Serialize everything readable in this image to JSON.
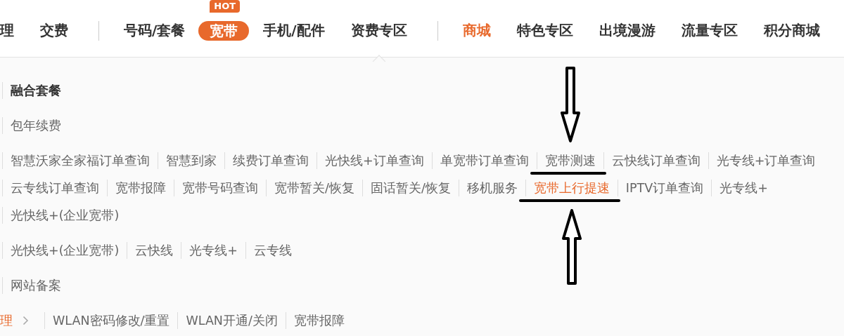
{
  "nav": [
    {
      "label": "理",
      "selected": false,
      "kind": "link"
    },
    {
      "label": "交费",
      "selected": false,
      "kind": "link"
    },
    {
      "kind": "divider"
    },
    {
      "label": "号码/套餐",
      "selected": false,
      "kind": "link"
    },
    {
      "label": "宽带",
      "selected": false,
      "kind": "hot",
      "badge": "HOT"
    },
    {
      "label": "手机/配件",
      "selected": false,
      "kind": "link"
    },
    {
      "label": "资费专区",
      "selected": false,
      "kind": "link",
      "pointer": true
    },
    {
      "kind": "divider"
    },
    {
      "label": "商城",
      "selected": true,
      "kind": "link"
    },
    {
      "label": "特色专区",
      "selected": false,
      "kind": "link"
    },
    {
      "label": "出境漫游",
      "selected": false,
      "kind": "link"
    },
    {
      "label": "流量专区",
      "selected": false,
      "kind": "link"
    },
    {
      "label": "积分商城",
      "selected": false,
      "kind": "link"
    }
  ],
  "groups": [
    {
      "kind": "heading",
      "lines": [
        [
          {
            "label": "融合套餐",
            "selected": false
          }
        ]
      ]
    },
    {
      "kind": "list",
      "lines": [
        [
          {
            "label": "包年续费",
            "selected": false
          }
        ]
      ]
    },
    {
      "kind": "list",
      "lines": [
        [
          {
            "label": "智慧沃家全家福订单查询",
            "selected": false
          },
          {
            "label": "智慧到家",
            "selected": false
          },
          {
            "label": "续费订单查询",
            "selected": false
          },
          {
            "label": "光快线+订单查询",
            "selected": false
          },
          {
            "label": "单宽带订单查询",
            "selected": false
          },
          {
            "label": "宽带测速",
            "selected": false,
            "arrow_above": true
          },
          {
            "label": "云快线订单查询",
            "selected": false
          },
          {
            "label": "光专线+订单查询",
            "selected": false
          }
        ],
        [
          {
            "label": "云专线订单查询",
            "selected": false
          },
          {
            "label": "宽带报障",
            "selected": false
          },
          {
            "label": "宽带号码查询",
            "selected": false
          },
          {
            "label": "宽带暂关/恢复",
            "selected": false
          },
          {
            "label": "固话暂关/恢复",
            "selected": false
          },
          {
            "label": "移机服务",
            "selected": false
          },
          {
            "label": "宽带上行提速",
            "selected": true,
            "arrow_below": true
          },
          {
            "label": "IPTV订单查询",
            "selected": false
          },
          {
            "label": "光专线+",
            "selected": false
          }
        ],
        [
          {
            "label": "光快线+(企业宽带)",
            "selected": false
          }
        ]
      ]
    },
    {
      "kind": "list",
      "lines": [
        [
          {
            "label": "光快线+(企业宽带)",
            "selected": false
          },
          {
            "label": "云快线",
            "selected": false
          },
          {
            "label": "光专线+",
            "selected": false
          },
          {
            "label": "云专线",
            "selected": false
          }
        ]
      ]
    },
    {
      "kind": "list",
      "lines": [
        [
          {
            "label": "网站备案",
            "selected": false
          }
        ]
      ]
    },
    {
      "kind": "crumb",
      "lead": "理",
      "lines": [
        [
          {
            "label": "WLAN密码修改/重置",
            "selected": false
          },
          {
            "label": "WLAN开通/关闭",
            "selected": false
          },
          {
            "label": "宽带报障",
            "selected": false
          }
        ]
      ]
    }
  ]
}
